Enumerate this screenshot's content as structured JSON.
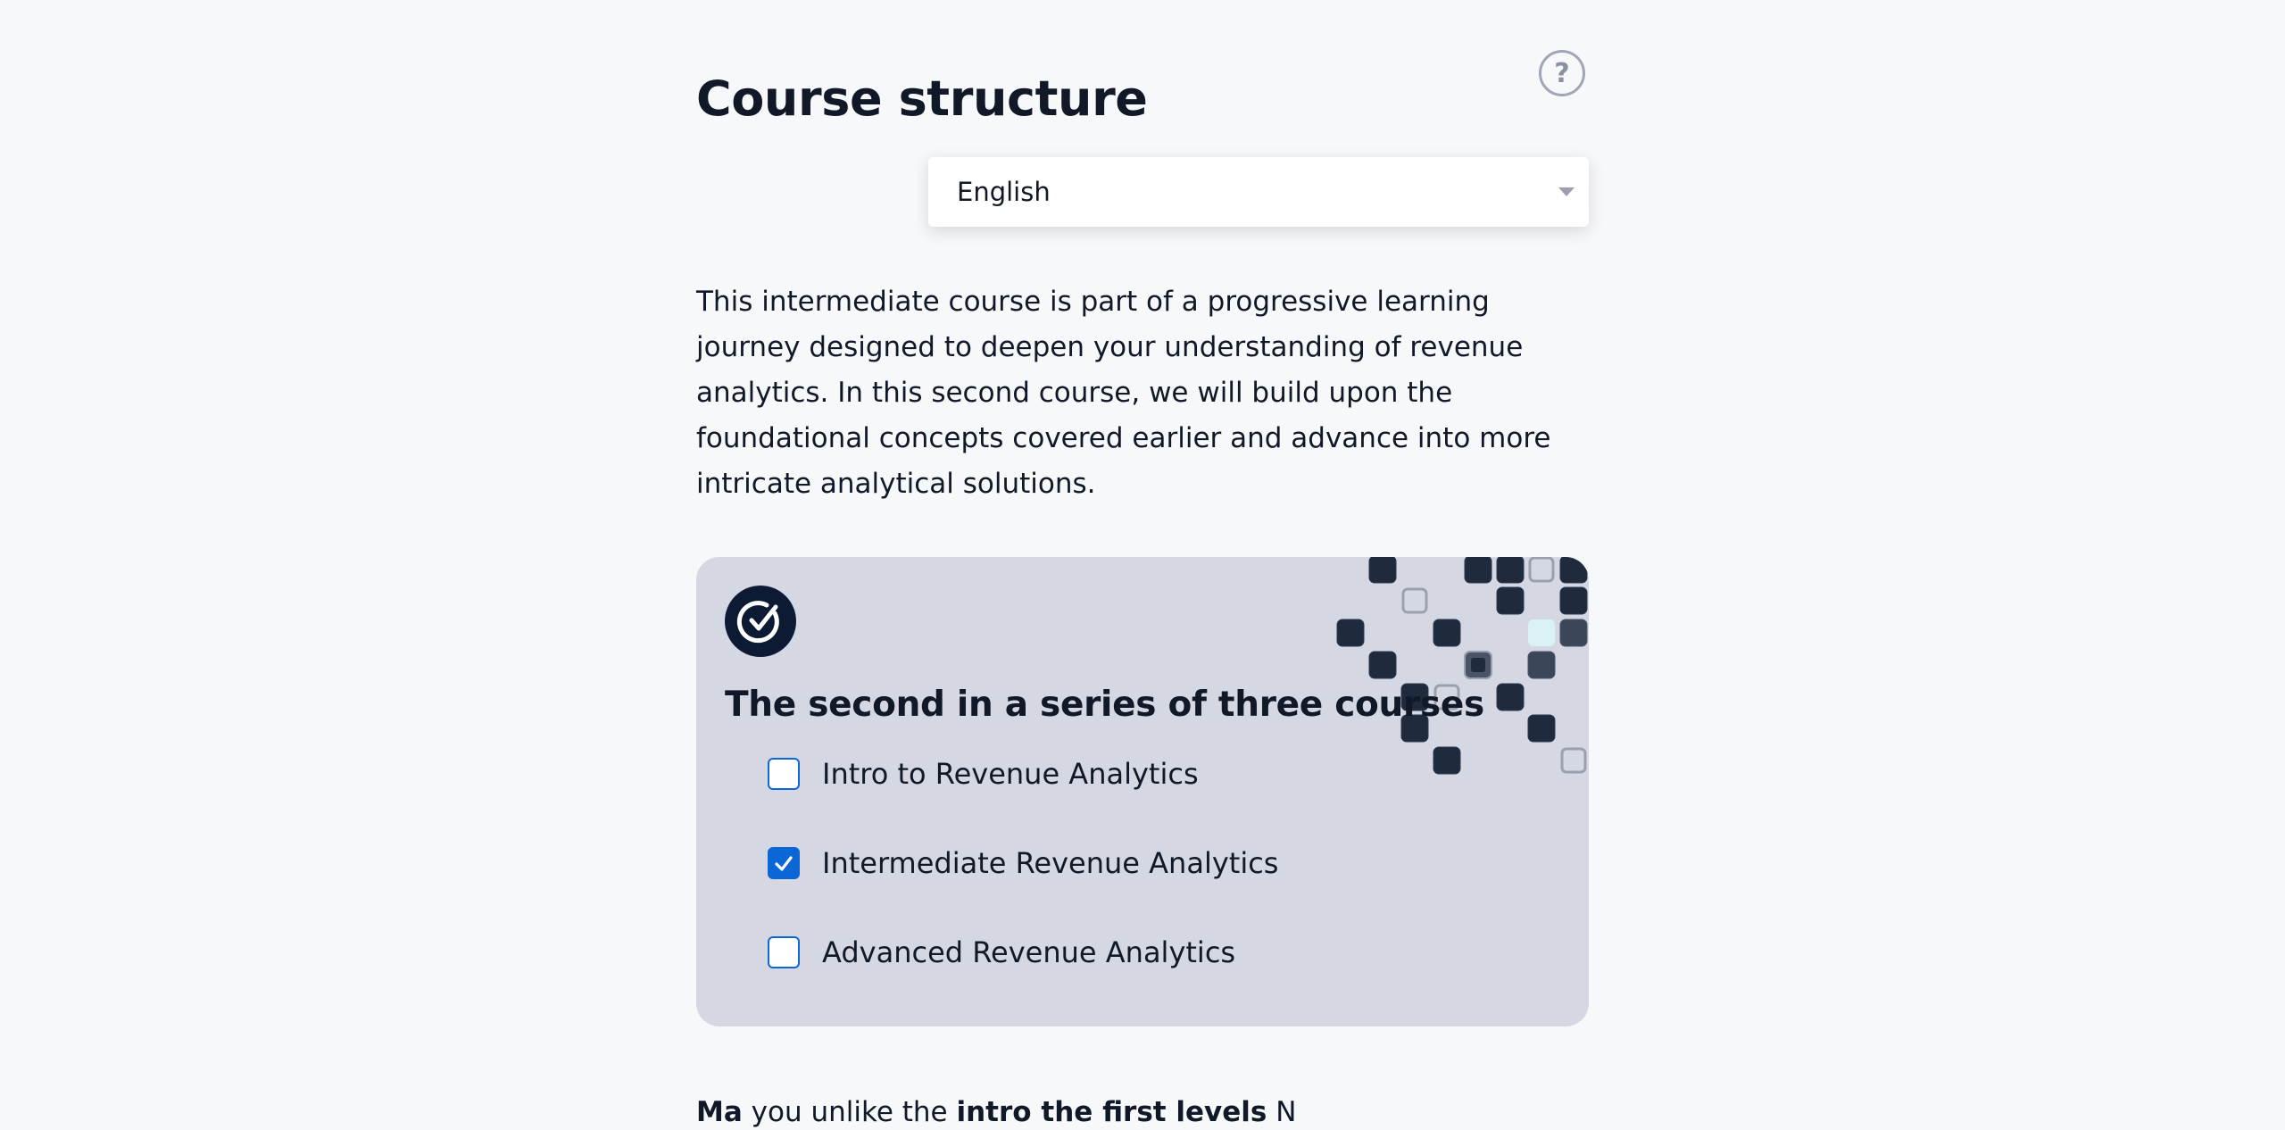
{
  "header": {
    "title": "Course structure",
    "help_label": "?"
  },
  "language_select": {
    "value": "English"
  },
  "intro": {
    "text": "This intermediate course is part of a progressive learning journey designed to deepen your understanding of revenue analytics. In this second course, we will build upon the foundational concepts covered earlier and advance into more intricate analytical solutions."
  },
  "series_card": {
    "title": "The second in a series of three courses",
    "courses": [
      {
        "label": "Intro to Revenue Analytics",
        "checked": false
      },
      {
        "label": "Intermediate Revenue Analytics",
        "checked": true
      },
      {
        "label": "Advanced Revenue Analytics",
        "checked": false
      }
    ]
  },
  "footer_partial": {
    "lead": "Ma",
    "middle": " you unlike the ",
    "bold": "intro the first levels",
    "tail": " N"
  },
  "colors": {
    "page_bg": "#f7f8fa",
    "card_bg": "#d5d7e2",
    "accent": "#0b67d6",
    "badge_dark": "#0d1a33"
  }
}
